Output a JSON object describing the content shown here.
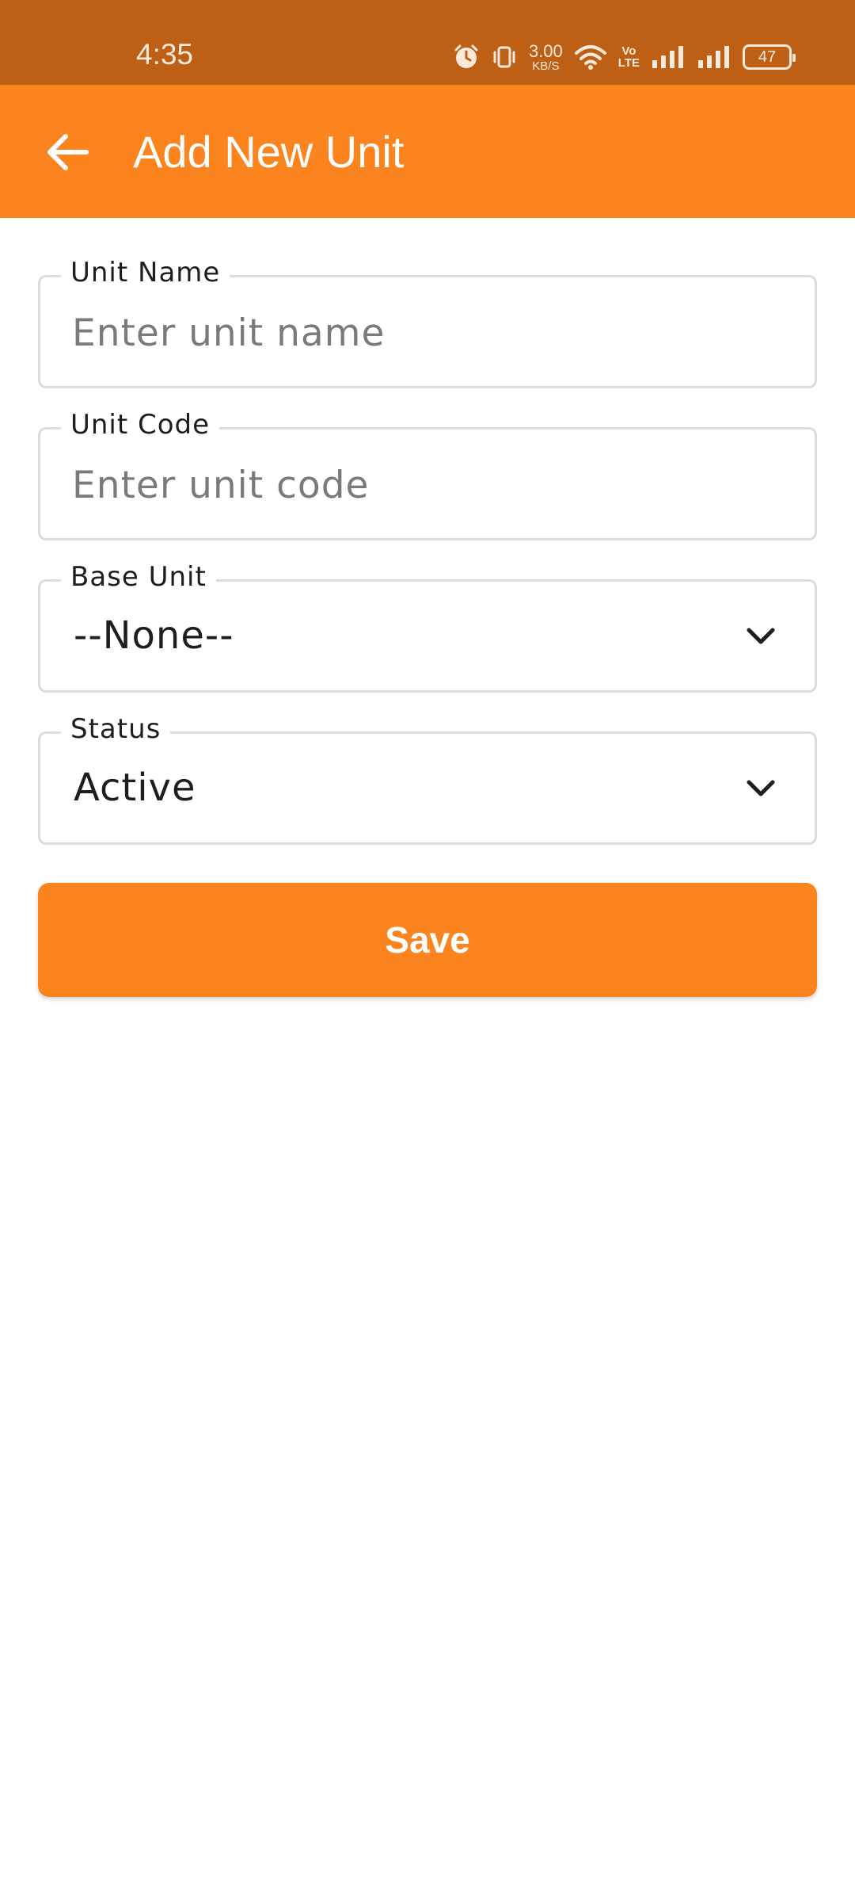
{
  "status_bar": {
    "time": "4:35",
    "net_speed_value": "3.00",
    "net_speed_unit": "KB/S",
    "volte_top": "Vo",
    "volte_bottom": "LTE",
    "battery": "47"
  },
  "app_bar": {
    "title": "Add New Unit",
    "back_icon": "arrow-left-icon",
    "color": "#fb841e"
  },
  "form": {
    "unit_name": {
      "label": "Unit Name",
      "placeholder": "Enter unit name",
      "value": ""
    },
    "unit_code": {
      "label": "Unit Code",
      "placeholder": "Enter unit code",
      "value": ""
    },
    "base_unit": {
      "label": "Base Unit",
      "selected": "--None--"
    },
    "status": {
      "label": "Status",
      "selected": "Active"
    },
    "save_label": "Save"
  },
  "colors": {
    "status_bar": "#bd5f14",
    "accent": "#fb841e",
    "field_border": "#dcdcdc"
  }
}
